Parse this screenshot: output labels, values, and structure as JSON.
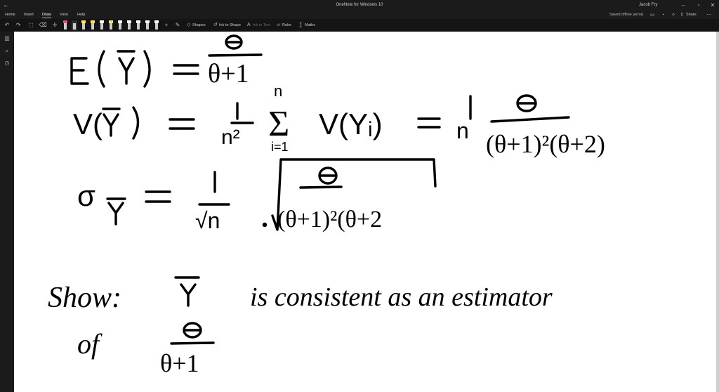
{
  "window": {
    "title": "OneNote for Windows 10",
    "user": "Jacob Fry",
    "back_icon": "arrow-left-icon",
    "min_icon": "minimize-icon",
    "max_icon": "maximize-icon",
    "close_icon": "close-icon"
  },
  "menu": {
    "tabs": [
      "Home",
      "Insert",
      "Draw",
      "View",
      "Help"
    ],
    "active": "Draw",
    "status": "Saved offline (error)",
    "share_label": "Share"
  },
  "ribbon": {
    "pen_colors": [
      "#e04b8a",
      "#2c2c2c",
      "#ffe14d",
      "#ffe14d",
      "#ffffff",
      "#ffe14d",
      "#ffffff",
      "#ffffff",
      "#ffffff",
      "#ffffff",
      "#ffffff"
    ],
    "shapes_label": "Shapes",
    "ink_to_shape_label": "Ink to Shape",
    "ink_to_text_label": "Ink to Text",
    "ruler_label": "Ruler",
    "maths_label": "Maths"
  },
  "sidebar": {
    "icons": [
      "notebooks-icon",
      "search-icon",
      "recent-icon"
    ]
  },
  "note": {
    "line1": {
      "lhs": "E(Ȳ)",
      "numerator": "θ",
      "denominator": "θ+1"
    },
    "line2": {
      "lhs": "V(Ȳ)",
      "factor_num": "1",
      "factor_den": "n²",
      "sum_top": "n",
      "sum_bottom": "i=1",
      "term": "V(Yᵢ)",
      "rhs_factor_num": "1",
      "rhs_factor_den": "n",
      "rhs_num": "θ",
      "rhs_den": "(θ+1)²(θ+2)"
    },
    "line3": {
      "lhs": "σȲ",
      "factor_num": "1",
      "factor_den": "√n",
      "root_num": "θ",
      "root_den": "(θ+1)²(θ+2"
    },
    "line4": {
      "show": "Show:",
      "ybar": "Ȳ",
      "text": "is consistent as an estimator"
    },
    "line5": {
      "of": "of",
      "numerator": "θ",
      "denominator": "θ+1"
    }
  }
}
